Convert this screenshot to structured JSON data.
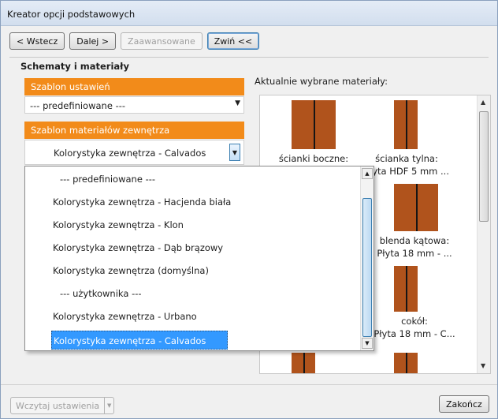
{
  "window": {
    "title": "Kreator opcji podstawowych"
  },
  "toolbar": {
    "back_label": "< Wstecz",
    "next_label": "Dalej >",
    "advanced_label": "Zaawansowane",
    "collapse_label": "Zwiń <<"
  },
  "group": {
    "title": "Schematy i materiały"
  },
  "settings_template": {
    "header": "Szablon ustawień",
    "value": "--- predefiniowane ---"
  },
  "materials_template": {
    "header": "Szablon materiałów zewnętrza",
    "value": "Kolorystyka zewnętrza - Calvados"
  },
  "selected_materials": {
    "label": "Aktualnie wybrane materiały:",
    "items": [
      {
        "line1": "ścianki boczne:",
        "line2": ""
      },
      {
        "line1": "ścianka tylna:",
        "line2": "Płyta HDF 5 mm ..."
      },
      {
        "line1": "blenda kątowa:",
        "line2": "Płyta 18 mm - ..."
      },
      {
        "line1": "cokół:",
        "line2": "Płyta 18 mm - C..."
      }
    ],
    "swatch_color": "#b0531c"
  },
  "dropdown": {
    "options": [
      "--- predefiniowane ---",
      "Kolorystyka zewnętrza - Hacjenda biała",
      "Kolorystyka zewnętrza - Klon",
      "Kolorystyka zewnętrza - Dąb brązowy",
      "Kolorystyka zewnętrza (domyślna)",
      "--- użytkownika ---",
      "Kolorystyka zewnętrza - Urbano",
      "Kolorystyka zewnętrza - Calvados"
    ],
    "selected": "Kolorystyka zewnętrza - Calvados"
  },
  "footer": {
    "load_label": "Wczytaj ustawienia",
    "finish_label": "Zakończ"
  },
  "colors": {
    "accent": "#f28b1a",
    "selection": "#3399ff"
  }
}
